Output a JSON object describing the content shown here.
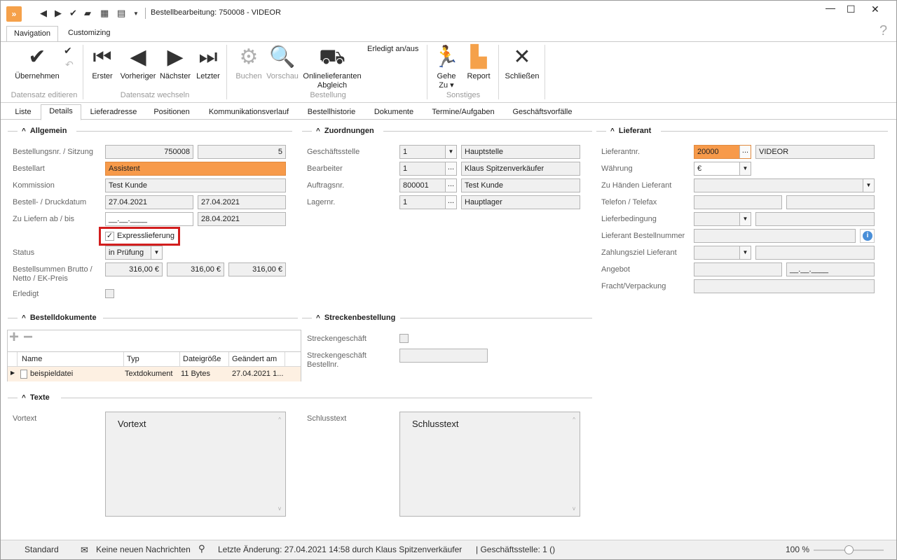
{
  "window": {
    "title": "Bestellbearbeitung: 750008 - VIDEOR",
    "app_icon": "app-logo-icon",
    "minimize": "—",
    "maximize": "☐",
    "close": "✕"
  },
  "ribbon_tabs": [
    "Navigation",
    "Customizing"
  ],
  "help_icon": "?",
  "ribbon": {
    "uebernehmen": "Übernehmen",
    "group_datensatz_editieren": "Datensatz editieren",
    "erster": "Erster",
    "vorheriger": "Vorheriger",
    "naechster": "Nächster",
    "letzter": "Letzter",
    "group_datensatz_wechseln": "Datensatz wechseln",
    "buchen": "Buchen",
    "vorschau": "Vorschau",
    "onlinelieferanten_1": "Onlinelieferanten",
    "onlinelieferanten_2": "Abgleich",
    "erledigt_anaus": "Erledigt an/aus",
    "group_bestellung": "Bestellung",
    "gehe_1": "Gehe",
    "gehe_2": "Zu ▾",
    "report": "Report",
    "group_sonstiges": "Sonstiges",
    "schliessen": "Schließen"
  },
  "tabs": [
    "Liste",
    "Details",
    "Lieferadresse",
    "Positionen",
    "Kommunikationsverlauf",
    "Bestellhistorie",
    "Dokumente",
    "Termine/Aufgaben",
    "Geschäftsvorfälle"
  ],
  "allgemein": {
    "title": "Allgemein",
    "bestellnr_label": "Bestellungsnr. / Sitzung",
    "bestellnr": "750008",
    "sitzung": "5",
    "bestellart_label": "Bestellart",
    "bestellart": "Assistent",
    "kommission_label": "Kommission",
    "kommission": "Test Kunde",
    "datum_label": "Bestell- / Druckdatum",
    "bestelldatum": "27.04.2021",
    "druckdatum": "27.04.2021",
    "liefern_label": "Zu Liefern ab / bis",
    "liefern_ab": "__.__.____",
    "liefern_bis": "28.04.2021",
    "express_label": "Expresslieferung",
    "express_checked": "✓",
    "status_label": "Status",
    "status": "in Prüfung",
    "summen_label_1": "Bestellsummen Brutto /",
    "summen_label_2": "Netto / EK-Preis",
    "brutto": "316,00 €",
    "netto": "316,00 €",
    "ek": "316,00 €",
    "erledigt_label": "Erledigt"
  },
  "zuordnungen": {
    "title": "Zuordnungen",
    "geschaeftsstelle_label": "Geschäftsstelle",
    "geschaeftsstelle_nr": "1",
    "geschaeftsstelle": "Hauptstelle",
    "bearbeiter_label": "Bearbeiter",
    "bearbeiter_nr": "1",
    "bearbeiter": "Klaus Spitzenverkäufer",
    "auftragsnr_label": "Auftragsnr.",
    "auftragsnr": "800001",
    "auftrag_kunde": "Test Kunde",
    "lagernr_label": "Lagernr.",
    "lagernr": "1",
    "lager": "Hauptlager"
  },
  "lieferant": {
    "title": "Lieferant",
    "nr_label": "Lieferantnr.",
    "nr": "20000",
    "name": "VIDEOR",
    "waehrung_label": "Währung",
    "waehrung": "€",
    "zuhaenden_label": "Zu Händen Lieferant",
    "telefon_label": "Telefon / Telefax",
    "lieferbedingung_label": "Lieferbedingung",
    "bestellnummer_label": "Lieferant Bestellnummer",
    "zahlungsziel_label": "Zahlungsziel Lieferant",
    "angebot_label": "Angebot",
    "angebot_datum": "__.__.____",
    "fracht_label": "Fracht/Verpackung"
  },
  "bestelldokumente": {
    "title": "Bestelldokumente",
    "add": "+",
    "remove": "−",
    "columns": [
      "Name",
      "Typ",
      "Dateigröße",
      "Geändert am"
    ],
    "rows": [
      {
        "name": "beispieldatei",
        "typ": "Textdokument",
        "groesse": "11 Bytes",
        "geaendert": "27.04.2021 1..."
      }
    ]
  },
  "streckenbestellung": {
    "title": "Streckenbestellung",
    "geschaeft_label": "Streckengeschäft",
    "bestellnr_label_1": "Streckengeschäft",
    "bestellnr_label_2": "Bestellnr."
  },
  "texte": {
    "title": "Texte",
    "vortext_label": "Vortext",
    "vortext": "Vortext",
    "schlusstext_label": "Schlusstext",
    "schlusstext": "Schlusstext"
  },
  "statusbar": {
    "layout": "Standard",
    "nachrichten": "Keine neuen Nachrichten",
    "letzte_aenderung": "Letzte Änderung: 27.04.2021 14:58 durch Klaus Spitzenverkäufer",
    "geschaeftsstelle": "| Geschäftsstelle:  1 ()",
    "zoom": "100 %",
    "zoom_level": 0.5
  }
}
